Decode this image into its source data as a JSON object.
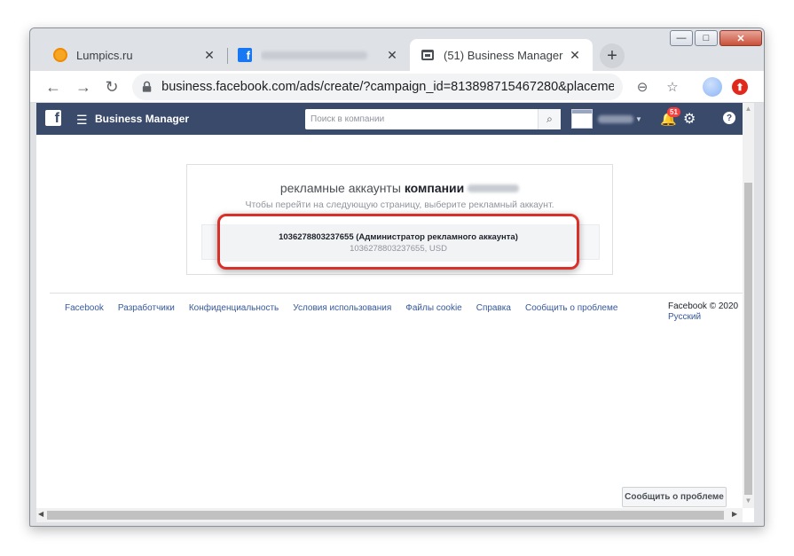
{
  "window": {
    "controls": {
      "minimize": "—",
      "maximize": "□",
      "close": "✕"
    }
  },
  "tabs": [
    {
      "label": "Lumpics.ru",
      "icon": "lumpics-orange-icon",
      "close": "✕"
    },
    {
      "label": "",
      "icon": "facebook-icon",
      "close": "✕"
    },
    {
      "label": "(51) Business Manager",
      "icon": "business-manager-icon",
      "close": "✕"
    }
  ],
  "new_tab": "+",
  "toolbar": {
    "back": "←",
    "forward": "→",
    "reload": "↻",
    "url": "business.facebook.com/ads/create/?campaign_id=813898715467280&placement=...",
    "zoom": "⊖",
    "star": "☆",
    "extension": "⬆"
  },
  "fb_header": {
    "logo": "f",
    "menu": "☰",
    "title": "Business Manager",
    "search_placeholder": "Поиск в компании",
    "search_icon": "⌕",
    "notifications_count": "51",
    "bell": "🔔",
    "gear": "⚙",
    "help": "?"
  },
  "card": {
    "title_prefix": "рекламные аккаунты",
    "title_bold": "компании",
    "subtitle": "Чтобы перейти на следующую страницу, выберите рекламный аккаунт.",
    "account_name": "1036278803237655 (Администратор рекламного аккаунта)",
    "account_id": "1036278803237655, USD"
  },
  "footer": {
    "links": [
      "Facebook",
      "Разработчики",
      "Конфиденциальность",
      "Условия использования",
      "Файлы cookie",
      "Справка",
      "Сообщить о проблеме"
    ],
    "copyright": "Facebook © 2020",
    "language": "Русский"
  },
  "report_button": "Сообщить о проблеме"
}
